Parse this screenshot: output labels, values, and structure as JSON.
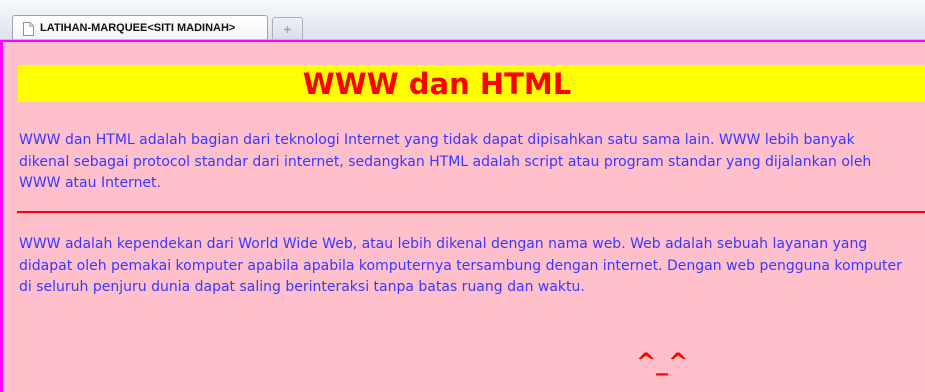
{
  "browser": {
    "tab_title": "LATIHAN-MARQUEE<SITI MADINAH>",
    "new_tab_icon": "plus-icon",
    "tab_icon": "page-icon"
  },
  "page": {
    "heading": "WWW dan HTML",
    "paragraph_1": "WWW dan HTML adalah bagian dari teknologi Internet yang tidak dapat dipisahkan satu sama lain. WWW lebih banyak dikenal sebagai protocol standar dari internet, sedangkan HTML adalah script atau program standar yang dijalankan oleh WWW atau Internet.",
    "paragraph_2": "WWW adalah kependekan dari World Wide Web, atau lebih dikenal dengan nama web. Web adalah sebuah layanan yang didapat oleh pemakai komputer apabila apabila komputernya tersambung dengan internet. Dengan web pengguna komputer di seluruh penjuru dunia dapat saling berinteraksi tanpa batas ruang dan waktu.",
    "marquee_text": "^_^"
  },
  "colors": {
    "page_background": "#ffc0cb",
    "heading_band": "#ffff00",
    "heading_text": "#ff0000",
    "body_text": "#3838ff",
    "rule": "#ff0000",
    "frame_border": "#ff00ff"
  }
}
